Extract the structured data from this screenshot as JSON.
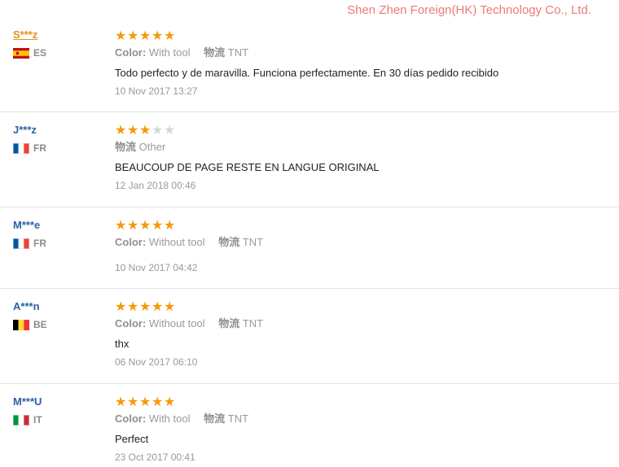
{
  "watermark": "Shen Zhen Foreign(HK) Technology Co., Ltd.",
  "colors": {
    "star_on": "#f59a0b",
    "star_off": "#d7d7d7",
    "name": "#2a61a6",
    "name_active": "#e88f14"
  },
  "reviews": [
    {
      "name": "S***z",
      "country": "ES",
      "flag": "spain-flag",
      "rating": 5,
      "color_key": "Color:",
      "color_value": "With tool",
      "shipping_key": "物流",
      "shipping_value": "TNT",
      "text": "Todo perfecto y de maravilla. Funciona perfectamente. En 30 días pedido recibido",
      "date": "10 Nov 2017 13:27"
    },
    {
      "name": "J***z",
      "country": "FR",
      "flag": "france-flag",
      "rating": 3,
      "shipping_key": "物流",
      "shipping_value": "Other",
      "text": "BEAUCOUP DE PAGE RESTE EN LANGUE ORIGINAL",
      "date": "12 Jan 2018 00:46"
    },
    {
      "name": "M***e",
      "country": "FR",
      "flag": "france-flag",
      "rating": 5,
      "color_key": "Color:",
      "color_value": "Without tool",
      "shipping_key": "物流",
      "shipping_value": "TNT",
      "date": "10 Nov 2017 04:42"
    },
    {
      "name": "A***n",
      "country": "BE",
      "flag": "belgium-flag",
      "rating": 5,
      "color_key": "Color:",
      "color_value": "Without tool",
      "shipping_key": "物流",
      "shipping_value": "TNT",
      "text": "thx",
      "date": "06 Nov 2017 06:10"
    },
    {
      "name": "M***U",
      "country": "IT",
      "flag": "italy-flag",
      "rating": 5,
      "color_key": "Color:",
      "color_value": "With tool",
      "shipping_key": "物流",
      "shipping_value": "TNT",
      "text": "Perfect",
      "date": "23 Oct 2017 00:41"
    }
  ]
}
